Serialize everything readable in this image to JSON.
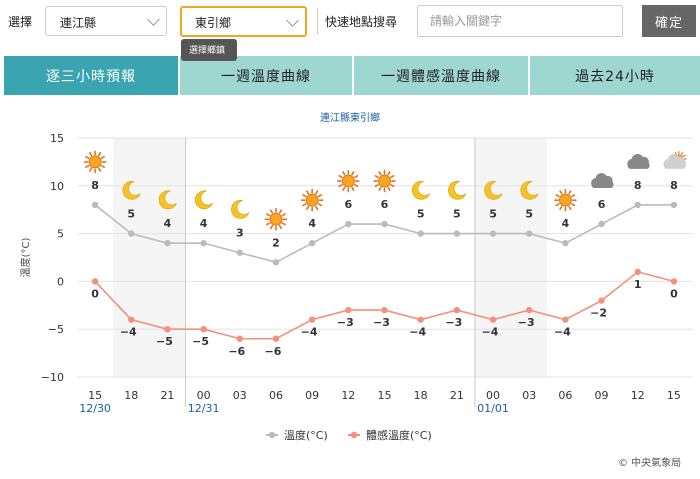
{
  "filter": {
    "select_label": "選擇",
    "county": "連江縣",
    "township": "東引鄉",
    "tooltip": "選擇鄉鎮",
    "search_label": "快速地點搜尋",
    "search_placeholder": "請輸入關鍵字",
    "confirm": "確定"
  },
  "tabs": [
    {
      "label": "逐三小時預報",
      "active": true
    },
    {
      "label": "一週溫度曲線",
      "active": false
    },
    {
      "label": "一週體感溫度曲線",
      "active": false
    },
    {
      "label": "過去24小時",
      "active": false
    }
  ],
  "chart_data": {
    "type": "line",
    "title": "連江縣東引鄉",
    "ylabel": "溫度(°C)",
    "ylim": [
      -10,
      15
    ],
    "yticks": [
      15,
      10,
      5,
      0,
      -5,
      -10
    ],
    "categories": [
      "15",
      "18",
      "21",
      "00",
      "03",
      "06",
      "09",
      "12",
      "15",
      "18",
      "21",
      "00",
      "03",
      "06",
      "09",
      "12",
      "15"
    ],
    "dates": [
      {
        "label": "12/30",
        "index": 0
      },
      {
        "label": "12/31",
        "index": 3
      },
      {
        "label": "01/01",
        "index": 11
      }
    ],
    "night_bands": [
      [
        1,
        3
      ],
      [
        11,
        13
      ]
    ],
    "day_dividers": [
      2.5,
      10.5
    ],
    "series": [
      {
        "name": "溫度(°C)",
        "color": "#bbbbbb",
        "values": [
          8,
          5,
          4,
          4,
          3,
          2,
          4,
          6,
          6,
          5,
          5,
          5,
          5,
          4,
          6,
          8,
          8
        ]
      },
      {
        "name": "體感溫度(°C)",
        "color": "#f4917a",
        "values": [
          0,
          -4,
          -5,
          -5,
          -6,
          -6,
          -4,
          -3,
          -3,
          -4,
          -3,
          -4,
          -3,
          -4,
          -2,
          1,
          0
        ]
      }
    ],
    "weather_icons": [
      "sun-icon",
      "moon-icon",
      "moon-icon",
      "moon-icon",
      "moon-icon",
      "sun-icon",
      "sun-icon",
      "sun-icon",
      "sun-icon",
      "moon-icon",
      "moon-icon",
      "moon-icon",
      "moon-icon",
      "sun-icon",
      "cloud-icon",
      "cloud-icon",
      "cloud-sun-icon"
    ],
    "legend_position": "bottom-center"
  },
  "copyright": "© 中央氣象局"
}
